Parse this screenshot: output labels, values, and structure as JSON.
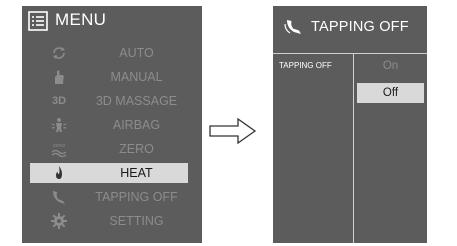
{
  "menu": {
    "title": "MENU",
    "icon": "menu-list-icon",
    "items": [
      {
        "label": "AUTO",
        "icon": "auto-cycle-icon"
      },
      {
        "label": "MANUAL",
        "icon": "hand-icon"
      },
      {
        "label": "3D MASSAGE",
        "icon": "3d-icon",
        "icon_text": "3D"
      },
      {
        "label": "AIRBAG",
        "icon": "airbag-person-icon"
      },
      {
        "label": "ZERO",
        "icon": "zero-gravity-icon"
      },
      {
        "label": "HEAT",
        "icon": "flame-icon"
      },
      {
        "label": "TAPPING OFF",
        "icon": "tapping-hand-icon"
      },
      {
        "label": "SETTING",
        "icon": "gear-icon"
      }
    ],
    "selected": "HEAT"
  },
  "arrow": {
    "icon": "right-arrow-icon"
  },
  "tapping_panel": {
    "title": "TAPPING OFF",
    "icon": "tapping-hand-icon",
    "row_label": "TAPPING OFF",
    "options": [
      "On",
      "Off"
    ],
    "selected": "Off"
  },
  "colors": {
    "panel_bg": "#5c5c5c",
    "highlight_bg": "#d9d9d9",
    "inactive_text": "#8c8c8c",
    "header_text": "#ffffff"
  }
}
